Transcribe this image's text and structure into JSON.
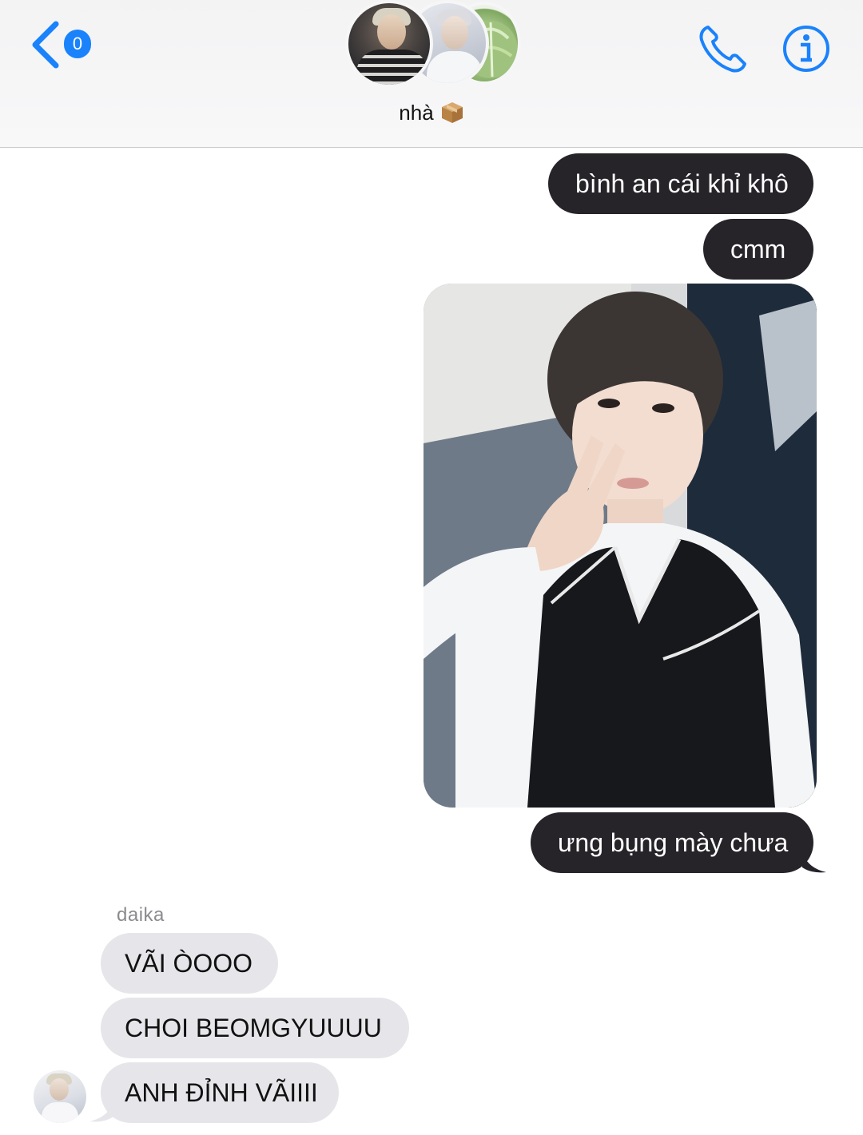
{
  "header": {
    "back_badge_count": "0",
    "group_name": "nhà",
    "group_name_emoji": "package-icon",
    "avatars": [
      "group-member-avatar-1",
      "group-member-avatar-2",
      "cabbage-avatar"
    ],
    "accent_color": "#1a82fb"
  },
  "messages": [
    {
      "direction": "outgoing",
      "type": "text",
      "text": "bình an cái khỉ khô"
    },
    {
      "direction": "outgoing",
      "type": "text",
      "text": "cmm"
    },
    {
      "direction": "outgoing",
      "type": "image"
    },
    {
      "direction": "outgoing",
      "type": "text",
      "text": "ưng bụng mày chưa"
    },
    {
      "direction": "incoming",
      "type": "sender_name",
      "text": "daika"
    },
    {
      "direction": "incoming",
      "type": "text",
      "text": "VÃI ÒOOO"
    },
    {
      "direction": "incoming",
      "type": "text",
      "text": "CHOI BEOMGYUUUU"
    },
    {
      "direction": "incoming",
      "type": "text",
      "text": "ANH ĐỈNH VÃIIII"
    }
  ],
  "colors": {
    "outgoing_bubble": "#262329",
    "incoming_bubble": "#e6e6ea",
    "header_bg": "#f4f4f5"
  }
}
